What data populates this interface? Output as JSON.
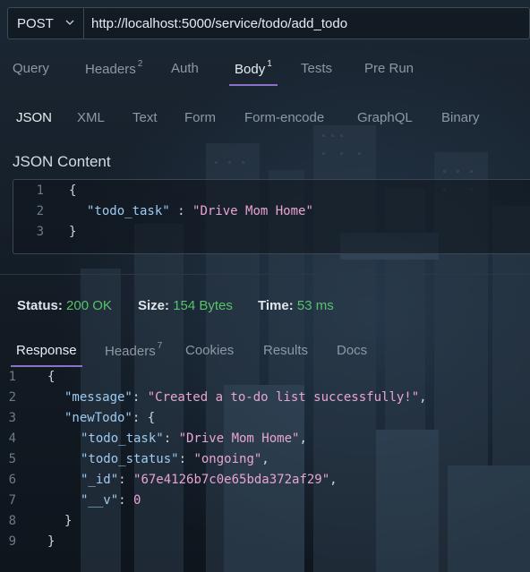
{
  "request": {
    "method": "POST",
    "url": "http://localhost:5000/service/todo/add_todo"
  },
  "request_tabs": [
    {
      "label": "Query",
      "badge": ""
    },
    {
      "label": "Headers",
      "badge": "2"
    },
    {
      "label": "Auth",
      "badge": ""
    },
    {
      "label": "Body",
      "badge": "1"
    },
    {
      "label": "Tests",
      "badge": ""
    },
    {
      "label": "Pre Run",
      "badge": ""
    }
  ],
  "active_request_tab": "Body",
  "body_types": [
    "JSON",
    "XML",
    "Text",
    "Form",
    "Form-encode",
    "GraphQL",
    "Binary"
  ],
  "active_body_type": "JSON",
  "json_content": {
    "title": "JSON Content",
    "lines": [
      {
        "num": "1",
        "text": "{"
      },
      {
        "num": "2",
        "key": "\"todo_task\"",
        "sep": " : ",
        "value": "\"Drive Mom Home\""
      },
      {
        "num": "3",
        "text": "}"
      }
    ]
  },
  "status_bar": {
    "status_label": "Status:",
    "status_value": "200 OK",
    "size_label": "Size:",
    "size_value": "154 Bytes",
    "time_label": "Time:",
    "time_value": "53 ms"
  },
  "response_tabs": [
    {
      "label": "Response",
      "badge": ""
    },
    {
      "label": "Headers",
      "badge": "7"
    },
    {
      "label": "Cookies",
      "badge": ""
    },
    {
      "label": "Results",
      "badge": ""
    },
    {
      "label": "Docs",
      "badge": ""
    }
  ],
  "active_response_tab": "Response",
  "response": {
    "lines": [
      {
        "num": "1",
        "punct_pre": "{"
      },
      {
        "num": "2",
        "key": "\"message\"",
        "sep": ": ",
        "str": "\"Created a to-do list successfully!\"",
        "punct_post": ","
      },
      {
        "num": "3",
        "key": "\"newTodo\"",
        "sep": ": ",
        "punct_post": "{"
      },
      {
        "num": "4",
        "key": "\"todo_task\"",
        "sep": ": ",
        "str": "\"Drive Mom Home\"",
        "punct_post": ","
      },
      {
        "num": "5",
        "key": "\"todo_status\"",
        "sep": ": ",
        "str": "\"ongoing\"",
        "punct_post": ","
      },
      {
        "num": "6",
        "key": "\"_id\"",
        "sep": ": ",
        "str": "\"67e4126b7c0e65bda372af29\"",
        "punct_post": ","
      },
      {
        "num": "7",
        "key": "\"__v\"",
        "sep": ": ",
        "str": "0",
        "punct_post": ""
      },
      {
        "num": "8",
        "punct_pre": "}"
      },
      {
        "num": "9",
        "punct_pre": "}"
      }
    ]
  },
  "colors": {
    "accent": "#8b72c9",
    "status_ok": "#58c26c",
    "json_key": "#9ecbf0",
    "json_string": "#e8a5d3"
  }
}
